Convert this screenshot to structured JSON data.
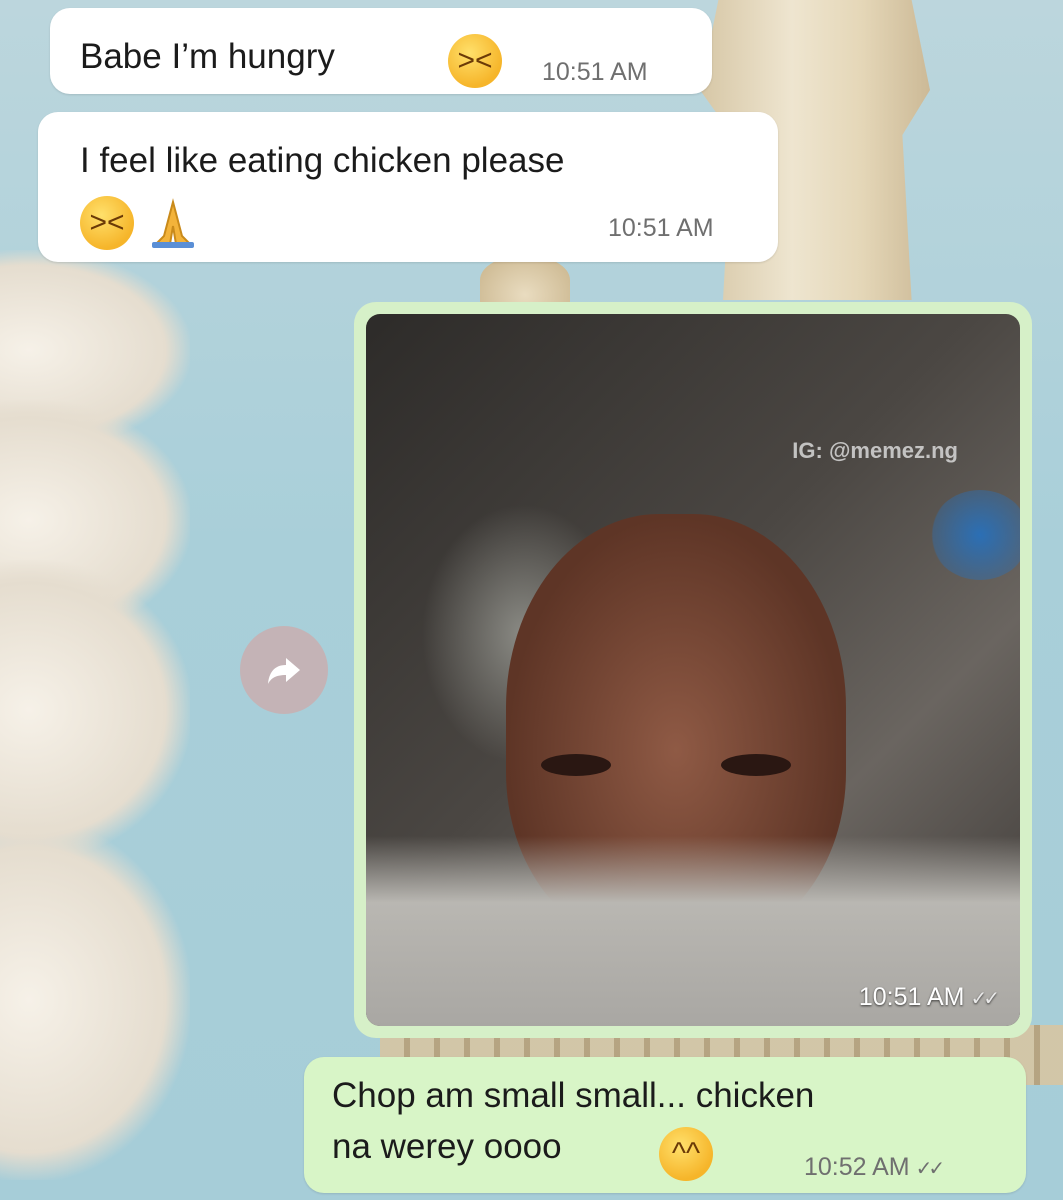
{
  "messages": [
    {
      "direction": "incoming",
      "text": "Babe I’m hungry",
      "emojis": [
        "weary-face"
      ],
      "time": "10:51 AM"
    },
    {
      "direction": "incoming",
      "text": "I feel like eating chicken please",
      "emojis": [
        "weary-face",
        "folded-hands"
      ],
      "time": "10:51 AM"
    },
    {
      "direction": "outgoing",
      "type": "image",
      "watermark": "IG: @memez.ng",
      "time": "10:51 AM",
      "status_icon": "double-check"
    },
    {
      "direction": "outgoing",
      "text_line1": "Chop am small small... chicken",
      "text_line2": "na werey oooo",
      "emojis": [
        "grinning-sweat-face"
      ],
      "time": "10:52 AM",
      "status_icon": "double-check"
    }
  ],
  "icons": {
    "forward": "forward-arrow-icon",
    "weary": "weary-face-emoji",
    "pray": "folded-hands-emoji",
    "sweat_smile": "grinning-sweat-emoji"
  },
  "colors": {
    "incoming_bubble": "#ffffff",
    "outgoing_bubble": "#d8f5c7",
    "timestamp": "#6f6f6f"
  }
}
